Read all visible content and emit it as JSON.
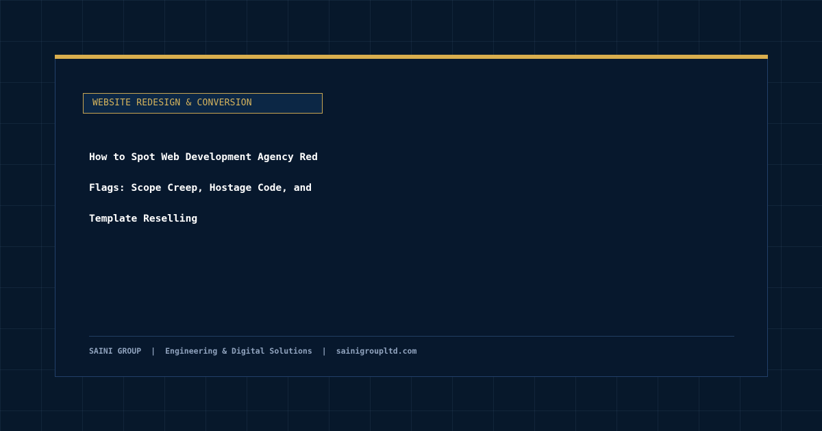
{
  "category": "WEBSITE REDESIGN & CONVERSION",
  "title": "How to Spot Web Development Agency Red Flags: Scope Creep, Hostage Code, and Template Reselling",
  "footer": {
    "company": "SAINI GROUP",
    "separator": "|",
    "tagline": "Engineering & Digital Solutions",
    "website": "sainigroupltd.com"
  },
  "colors": {
    "background": "#07182b",
    "accent": "#d9ae4e",
    "title": "#ffffff",
    "footer_text": "#8fa2bd"
  }
}
